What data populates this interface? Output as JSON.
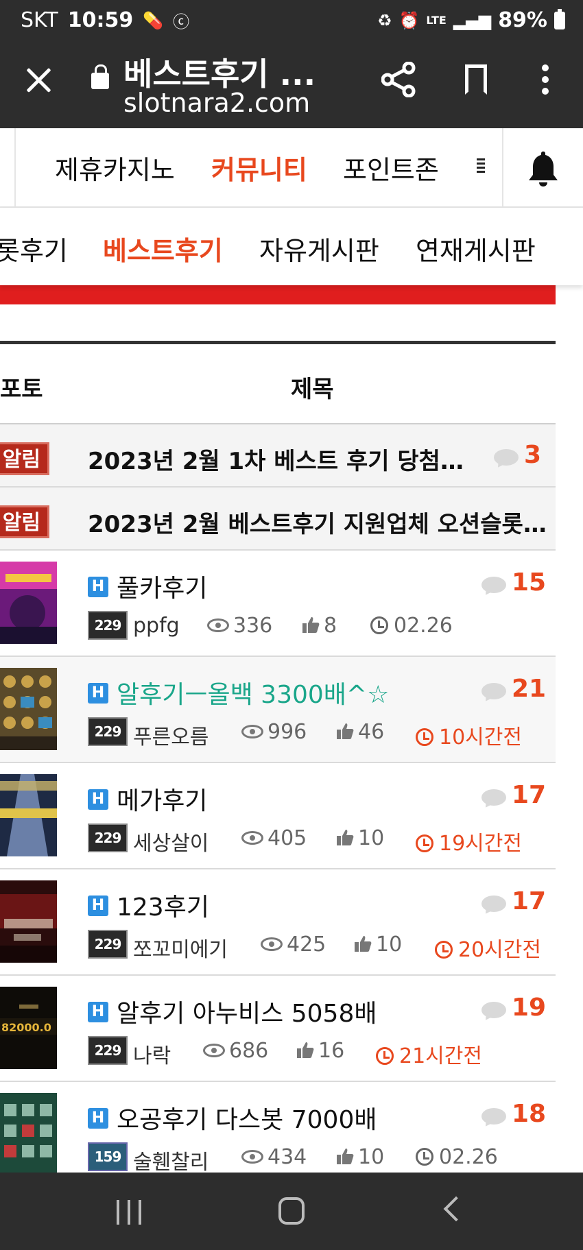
{
  "status_bar": {
    "carrier": "SKT",
    "time": "10:59",
    "battery": "89%",
    "network": "LTE"
  },
  "browser": {
    "page_title": "베스트후기 ...",
    "url": "slotnara2.com"
  },
  "main_nav": {
    "items": [
      "제휴카지노",
      "커뮤니티",
      "포인트존"
    ],
    "active": "커뮤니티"
  },
  "sub_nav": {
    "items": [
      "롯후기",
      "베스트후기",
      "자유게시판",
      "연재게시판"
    ],
    "active": "베스트후기"
  },
  "list_header": {
    "photo": "포토",
    "title": "제목"
  },
  "notices": [
    {
      "badge": "알림",
      "title": "2023년 2월 1차 베스트 후기 당첨자 ...",
      "comments": "3"
    },
    {
      "badge": "알림",
      "title": "2023년 2월 베스트후기 지원업체 오션슬롯 ..."
    }
  ],
  "posts": [
    {
      "badge": "H",
      "title": "풀카후기",
      "level": "229",
      "author": "ppfg",
      "views": "336",
      "likes": "8",
      "time": "02.26",
      "comments": "15"
    },
    {
      "badge": "H",
      "title": "알후기ㅡ올백 3300배^☆",
      "level": "229",
      "author": "푸른오름",
      "views": "996",
      "likes": "46",
      "time": "10시간전",
      "comments": "21"
    },
    {
      "badge": "H",
      "title": "메가후기",
      "level": "229",
      "author": "세상살이",
      "views": "405",
      "likes": "10",
      "time": "19시간전",
      "comments": "17"
    },
    {
      "badge": "H",
      "title": "123후기",
      "level": "229",
      "author": "쪼꼬미에기",
      "views": "425",
      "likes": "10",
      "time": "20시간전",
      "comments": "17"
    },
    {
      "badge": "H",
      "title": "알후기 아누비스 5058배",
      "level": "229",
      "author": "나락",
      "views": "686",
      "likes": "16",
      "time": "21시간전",
      "comments": "19"
    },
    {
      "badge": "H",
      "title": "오공후기 다스봇 7000배",
      "level": "159",
      "author": "술휀찰리",
      "views": "434",
      "likes": "10",
      "time": "02.26",
      "comments": "18"
    }
  ],
  "colors": {
    "accent": "#e8481e",
    "notice_badge": "#b52a1c",
    "hot_badge": "#2d8fe0",
    "highlight_title": "#1aa68a",
    "banner": "#e01e1e"
  }
}
